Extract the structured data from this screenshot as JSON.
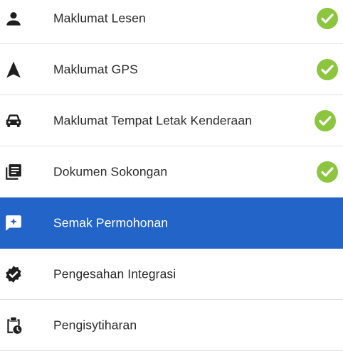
{
  "menu": {
    "items": [
      {
        "label": "Maklumat Lesen",
        "icon": "person-icon",
        "completed": true,
        "active": false
      },
      {
        "label": "Maklumat GPS",
        "icon": "navigation-arrow-icon",
        "completed": true,
        "active": false
      },
      {
        "label": "Maklumat Tempat Letak Kenderaan",
        "icon": "car-icon",
        "completed": true,
        "active": false
      },
      {
        "label": "Dokumen Sokongan",
        "icon": "documents-icon",
        "completed": true,
        "active": false
      },
      {
        "label": "Semak Permohonan",
        "icon": "chat-add-icon",
        "completed": false,
        "active": true
      },
      {
        "label": "Pengesahan Integrasi",
        "icon": "verified-badge-icon",
        "completed": false,
        "active": false
      },
      {
        "label": "Pengisytiharan",
        "icon": "clipboard-clock-icon",
        "completed": false,
        "active": false
      }
    ]
  },
  "colors": {
    "active_bg": "#2264c8",
    "check_green": "#8cc63f",
    "icon_dark": "#1f1f1f",
    "divider": "#e3e3e3"
  }
}
